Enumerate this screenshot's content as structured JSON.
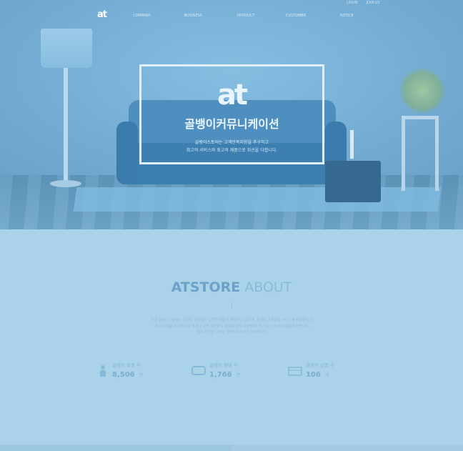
{
  "topbar": {
    "links": [
      "LOGIN",
      "JOIN US"
    ]
  },
  "header": {
    "logo_text": "at",
    "nav": [
      "COMPANY",
      "BUSINESS",
      "PRODUCT",
      "CUSTOMER",
      "NOTICE"
    ]
  },
  "hero": {
    "logo_text": "at",
    "title": "골뱅이커뮤니케이션",
    "subtitle_line1": "골뱅이스토어는 고객만족지향을 추구하고",
    "subtitle_line2": "최고의 서비스와 최고의 제품으로 최선을 다합니다."
  },
  "about": {
    "title_strong": "ATSTORE",
    "title_light": "ABOUT",
    "desc_line1": "지금 골뱅이스토어는 국내외 생산되는 다양한 제품을 판매하고 있으며, 최상의 고객만족 서비스를 제공합니다.",
    "desc_line2": "최고의 제품과 서비스로 언제나 고객 여러분의 만족을 위해 노력하며, 더 나은 서비스로 보답하겠습니다.",
    "desc_line3": "항상 최선을 다하는 골뱅이스토어가 되겠습니다.",
    "stats": [
      {
        "icon": "person-icon",
        "label": "골뱅이 회원 수",
        "value": "8,506",
        "unit": "명"
      },
      {
        "icon": "monitor-icon",
        "label": "골뱅이 판매 수",
        "value": "1,766",
        "unit": "건"
      },
      {
        "icon": "box-icon",
        "label": "골뱅이 상품 수",
        "value": "106",
        "unit": "개"
      }
    ]
  }
}
